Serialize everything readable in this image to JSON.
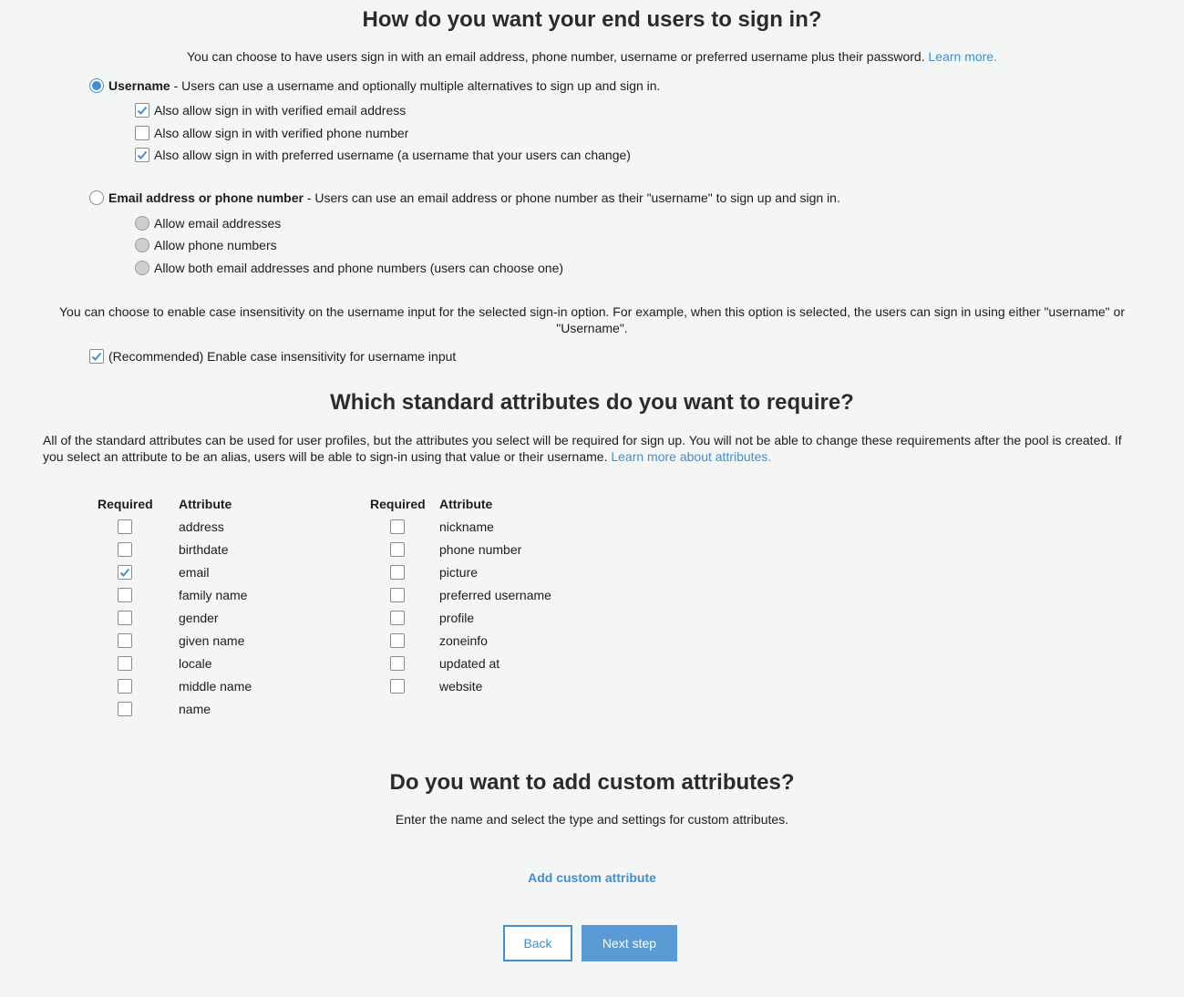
{
  "signin": {
    "heading": "How do you want your end users to sign in?",
    "intro": "You can choose to have users sign in with an email address, phone number, username or preferred username plus their password.",
    "learn_more": "Learn more.",
    "username_option": {
      "title": "Username",
      "desc": " - Users can use a username and optionally multiple alternatives to sign up and sign in.",
      "selected": true,
      "sub": [
        {
          "label": "Also allow sign in with verified email address",
          "checked": true
        },
        {
          "label": "Also allow sign in with verified phone number",
          "checked": false
        },
        {
          "label": "Also allow sign in with preferred username (a username that your users can change)",
          "checked": true
        }
      ]
    },
    "email_option": {
      "title": "Email address or phone number",
      "desc": " - Users can use an email address or phone number as their \"username\" to sign up and sign in.",
      "selected": false,
      "sub": [
        {
          "label": "Allow email addresses"
        },
        {
          "label": "Allow phone numbers"
        },
        {
          "label": "Allow both email addresses and phone numbers (users can choose one)"
        }
      ]
    },
    "case_note": "You can choose to enable case insensitivity on the username input for the selected sign-in option. For example, when this option is selected, the users can sign in using either \"username\" or \"Username\".",
    "case_checkbox": {
      "label": "(Recommended) Enable case insensitivity for username input",
      "checked": true
    }
  },
  "attributes": {
    "heading": "Which standard attributes do you want to require?",
    "intro": "All of the standard attributes can be used for user profiles, but the attributes you select will be required for sign up. You will not be able to change these requirements after the pool is created. If you select an attribute to be an alias, users will be able to sign-in using that value or their username.",
    "learn_more": "Learn more about attributes.",
    "col_required": "Required",
    "col_attribute": "Attribute",
    "left": [
      {
        "name": "address",
        "checked": false
      },
      {
        "name": "birthdate",
        "checked": false
      },
      {
        "name": "email",
        "checked": true
      },
      {
        "name": "family name",
        "checked": false
      },
      {
        "name": "gender",
        "checked": false
      },
      {
        "name": "given name",
        "checked": false
      },
      {
        "name": "locale",
        "checked": false
      },
      {
        "name": "middle name",
        "checked": false
      },
      {
        "name": "name",
        "checked": false
      }
    ],
    "right": [
      {
        "name": "nickname",
        "checked": false
      },
      {
        "name": "phone number",
        "checked": false
      },
      {
        "name": "picture",
        "checked": false
      },
      {
        "name": "preferred username",
        "checked": false
      },
      {
        "name": "profile",
        "checked": false
      },
      {
        "name": "zoneinfo",
        "checked": false
      },
      {
        "name": "updated at",
        "checked": false
      },
      {
        "name": "website",
        "checked": false
      }
    ]
  },
  "custom": {
    "heading": "Do you want to add custom attributes?",
    "intro": "Enter the name and select the type and settings for custom attributes.",
    "add_label": "Add custom attribute"
  },
  "actions": {
    "back": "Back",
    "next": "Next step"
  },
  "colors": {
    "accent": "#3f8fd2",
    "background": "#f4f6f5"
  }
}
